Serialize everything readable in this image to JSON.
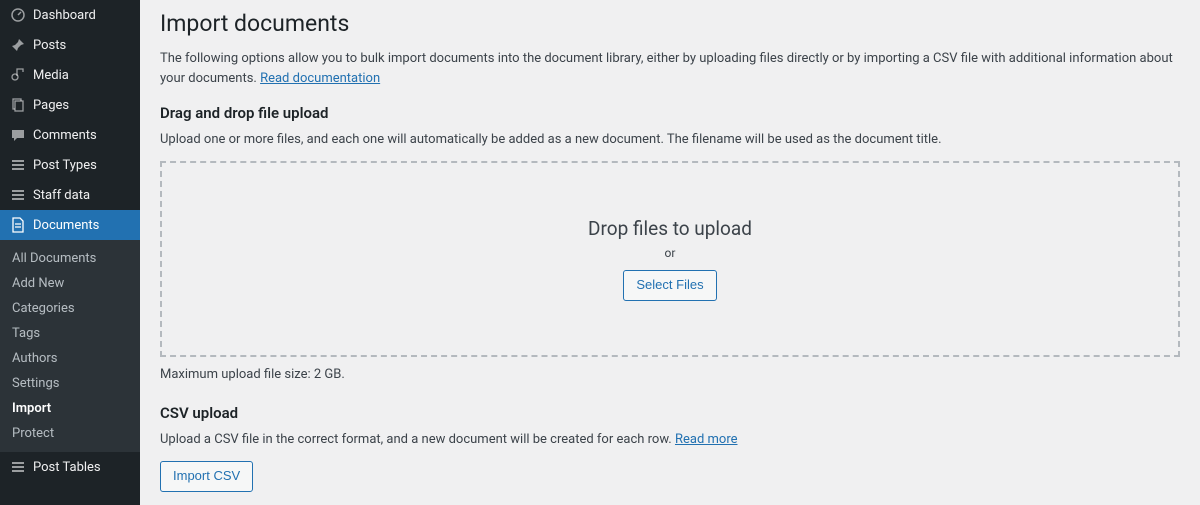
{
  "sidebar": {
    "items": [
      {
        "label": "Dashboard",
        "icon": "dashboard"
      },
      {
        "label": "Posts",
        "icon": "pin"
      },
      {
        "label": "Media",
        "icon": "media"
      },
      {
        "label": "Pages",
        "icon": "pages"
      },
      {
        "label": "Comments",
        "icon": "comment"
      },
      {
        "label": "Post Types",
        "icon": "list"
      },
      {
        "label": "Staff data",
        "icon": "list"
      },
      {
        "label": "Documents",
        "icon": "document",
        "active": true
      },
      {
        "label": "Post Tables",
        "icon": "list"
      }
    ],
    "submenu": [
      {
        "label": "All Documents"
      },
      {
        "label": "Add New"
      },
      {
        "label": "Categories"
      },
      {
        "label": "Tags"
      },
      {
        "label": "Authors"
      },
      {
        "label": "Settings"
      },
      {
        "label": "Import",
        "current": true
      },
      {
        "label": "Protect"
      }
    ]
  },
  "page": {
    "title": "Import documents",
    "intro_text": "The following options allow you to bulk import documents into the document library, either by uploading files directly or by importing a CSV file with additional information about your documents. ",
    "intro_link": "Read documentation",
    "section1_title": "Drag and drop file upload",
    "section1_hint": "Upload one or more files, and each one will automatically be added as a new document. The filename will be used as the document title.",
    "drop_title": "Drop files to upload",
    "drop_or": "or",
    "select_files_button": "Select Files",
    "max_size": "Maximum upload file size: 2 GB.",
    "section2_title": "CSV upload",
    "section2_hint": "Upload a CSV file in the correct format, and a new document will be created for each row. ",
    "section2_link": "Read more",
    "import_csv_button": "Import CSV"
  }
}
